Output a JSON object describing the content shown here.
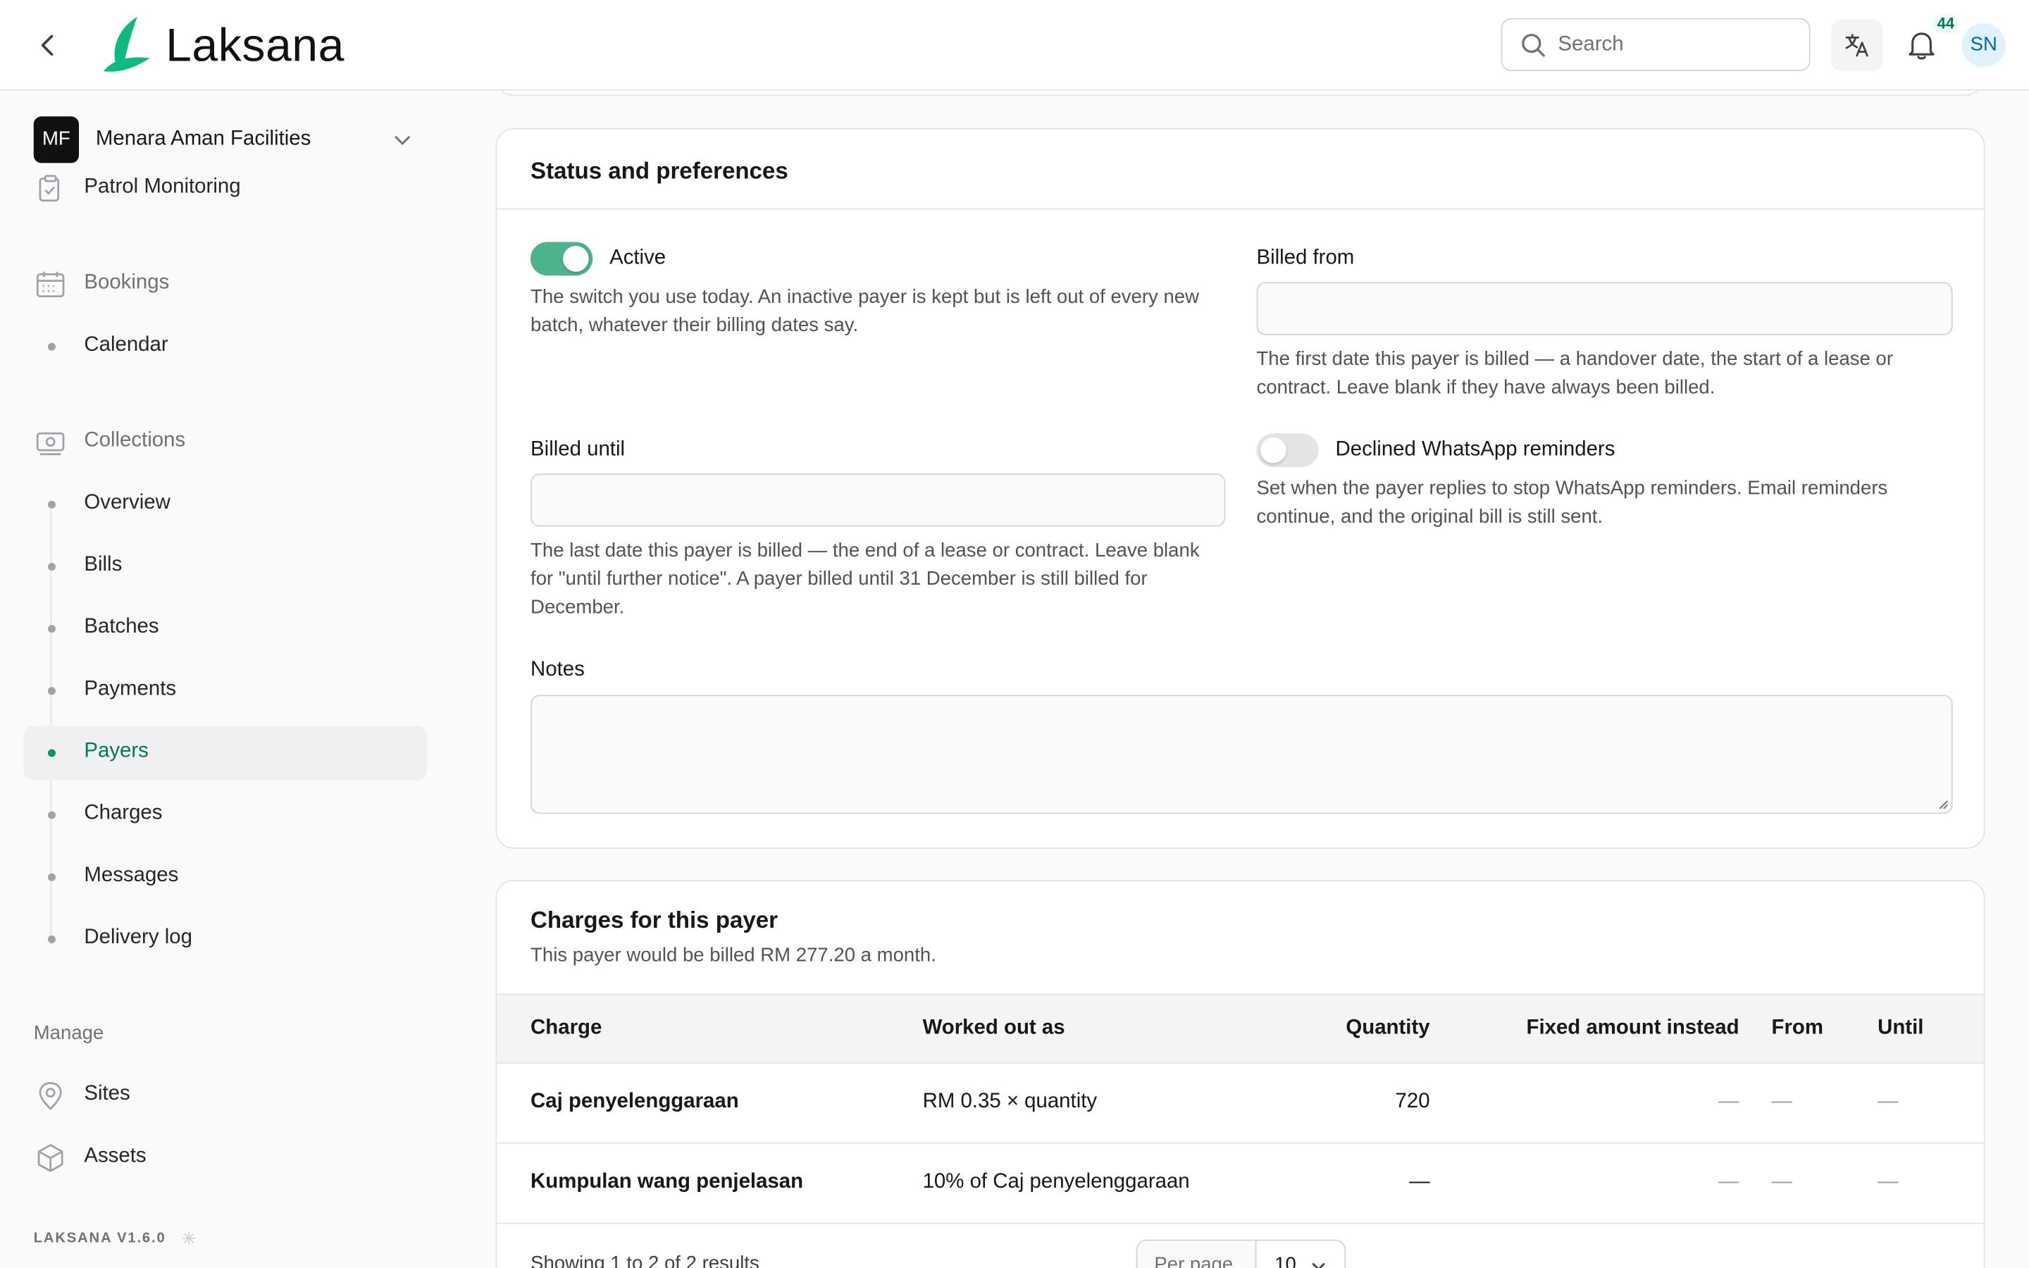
{
  "header": {
    "brand": "Laksana",
    "search_placeholder": "Search",
    "notification_count": "44",
    "avatar_initials": "SN"
  },
  "sidebar": {
    "org_initials": "MF",
    "org_name": "Menara Aman Facilities",
    "patrol": "Patrol Monitoring",
    "bookings": "Bookings",
    "calendar": "Calendar",
    "collections": "Collections",
    "collection_items": [
      "Overview",
      "Bills",
      "Batches",
      "Payments",
      "Payers",
      "Charges",
      "Messages",
      "Delivery log"
    ],
    "active_item": "Payers",
    "manage_label": "Manage",
    "sites": "Sites",
    "assets": "Assets",
    "version": "LAKSANA V1.6.0"
  },
  "status_card": {
    "title": "Status and preferences",
    "active_label": "Active",
    "active_on": true,
    "active_help": "The switch you use today. An inactive payer is kept but is left out of every new batch, whatever their billing dates say.",
    "billed_from_label": "Billed from",
    "billed_from_value": "",
    "billed_from_help": "The first date this payer is billed — a handover date, the start of a lease or contract. Leave blank if they have always been billed.",
    "billed_until_label": "Billed until",
    "billed_until_value": "",
    "billed_until_help": "The last date this payer is billed — the end of a lease or contract. Leave blank for \"until further notice\". A payer billed until 31 December is still billed for December.",
    "whatsapp_label": "Declined WhatsApp reminders",
    "whatsapp_on": false,
    "whatsapp_help": "Set when the payer replies to stop WhatsApp reminders. Email reminders continue, and the original bill is still sent.",
    "notes_label": "Notes",
    "notes_value": ""
  },
  "charges_card": {
    "title": "Charges for this payer",
    "subtitle": "This payer would be billed RM 277.20 a month.",
    "columns": {
      "charge": "Charge",
      "worked_out_as": "Worked out as",
      "quantity": "Quantity",
      "fixed": "Fixed amount instead",
      "from": "From",
      "until": "Until"
    },
    "rows": [
      {
        "charge": "Caj penyelenggaraan",
        "worked_out_as": "RM 0.35 × quantity",
        "quantity": "720",
        "fixed": "—",
        "from": "—",
        "until": "—"
      },
      {
        "charge": "Kumpulan wang penjelasan",
        "worked_out_as": "10% of Caj penyelenggaraan",
        "quantity": "—",
        "fixed": "—",
        "from": "—",
        "until": "—"
      }
    ],
    "footer_text": "Showing 1 to 2 of 2 results",
    "per_page_label": "Per page",
    "per_page_value": "10"
  },
  "colors": {
    "accent": "#059669",
    "toggle_on": "#4cb38a",
    "logo": "#10b981"
  }
}
